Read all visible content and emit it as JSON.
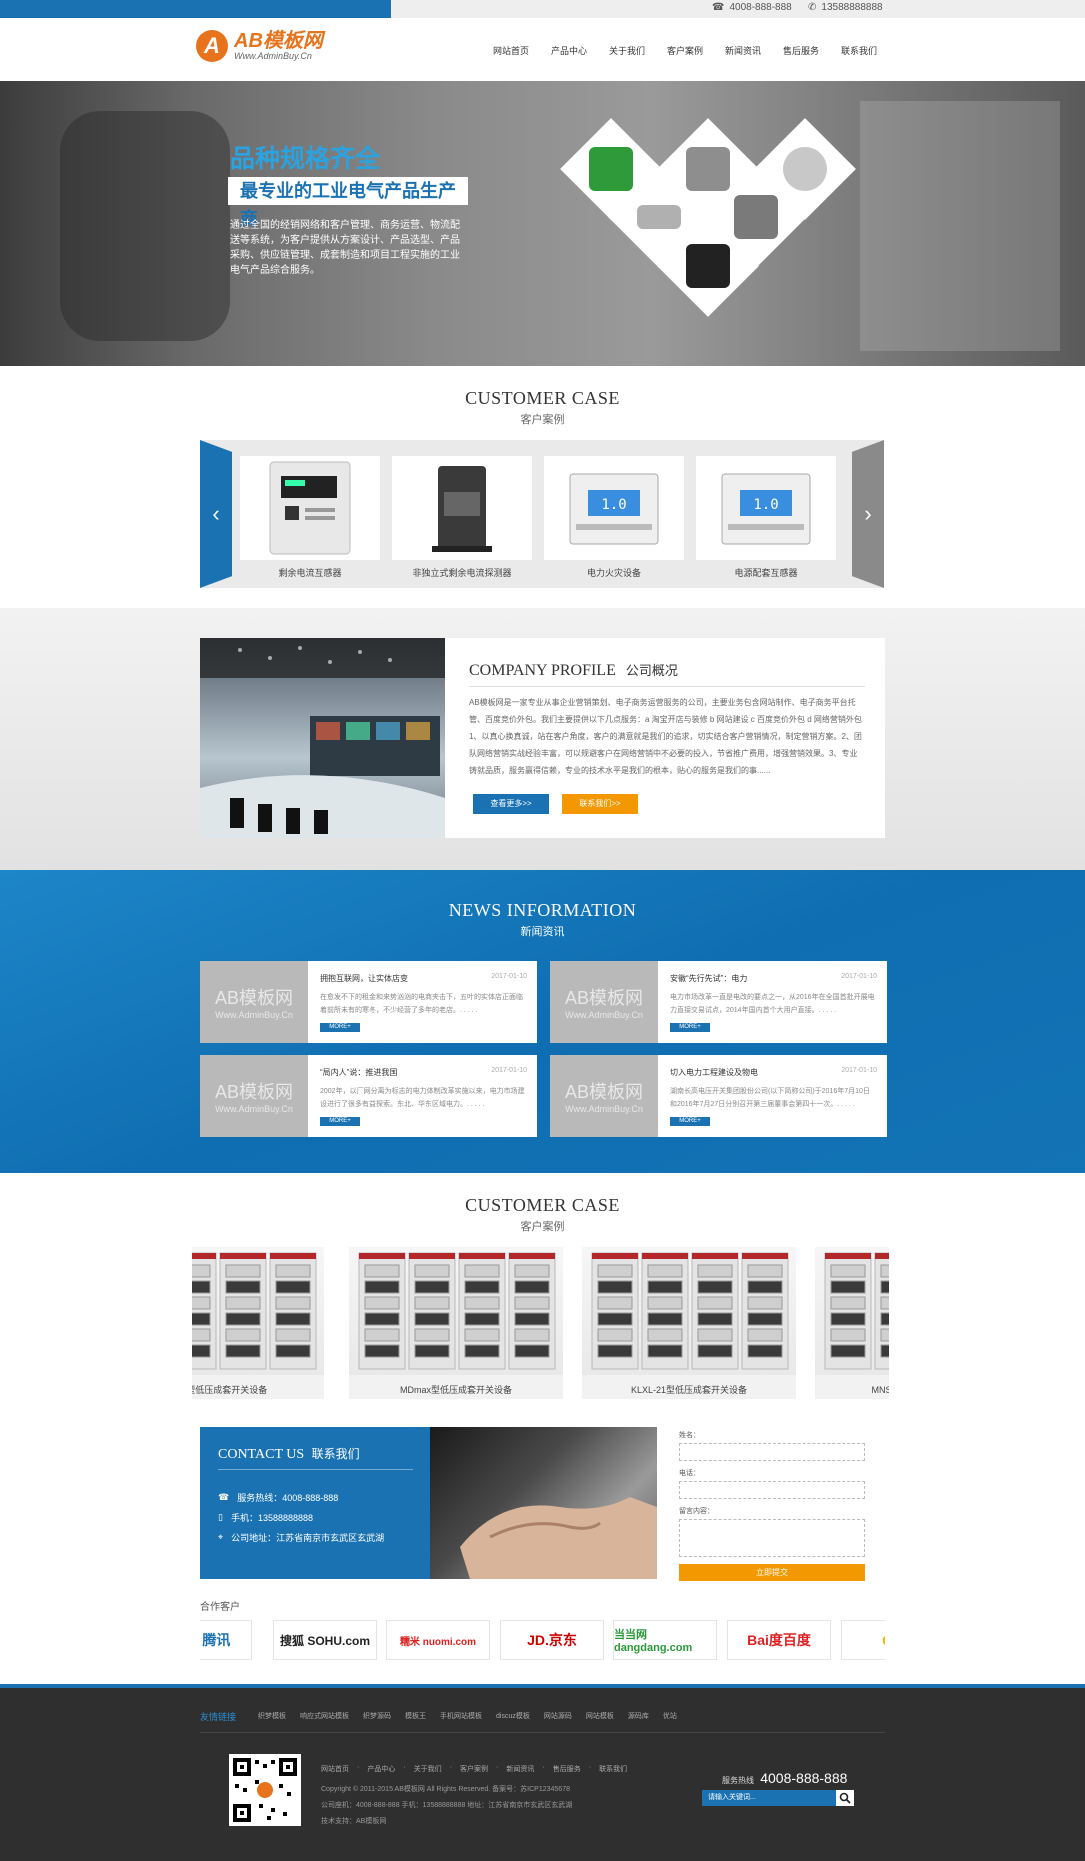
{
  "topbar": {
    "phone1": "4008-888-888",
    "phone2": "13588888888"
  },
  "header": {
    "logo_letter": "A",
    "logo_name": "AB模板网",
    "logo_sub": "Www.AdminBuy.Cn",
    "nav": [
      "网站首页",
      "产品中心",
      "关于我们",
      "客户案例",
      "新闻资讯",
      "售后服务",
      "联系我们"
    ]
  },
  "banner": {
    "headline": "品种规格齐全",
    "subheadline": "最专业的工业电气产品生产商",
    "text": "通过全国的经销网络和客户管理、商务运营、物流配送等系统，为客户提供从方案设计、产品选型、产品采购、供应链管理、成套制造和项目工程实施的工业电气产品综合服务。",
    "dot_colors": [
      "#2a8ed6",
      "#e6a21a",
      "#2a8ed6"
    ]
  },
  "case1": {
    "title_en": "CUSTOMER CASE",
    "title_cn": "客户案例",
    "prev": "‹",
    "next": "›",
    "items": [
      "剩余电流互感器",
      "非独立式剩余电流探测器",
      "电力火灾设备",
      "电源配套互感器"
    ]
  },
  "profile": {
    "title_en": "COMPANY PROFILE",
    "title_cn": "公司概况",
    "text": "AB模板网是一家专业从事企业营销策划、电子商务运营服务的公司，主要业务包含网站制作、电子商务平台托管、百度竞价外包。我们主要提供以下几点服务：a 淘宝开店与装修 b 网站建设 c 百度竞价外包 d 网络营销外包 1、以真心换真诚，站在客户角度，客户的满意就是我们的追求，切实结合客户营销情况，制定营销方案。2、团队网络营销实战经验丰富，可以规避客户在网络营销中不必要的投入，节省推广费用，增强营销效果。3、专业铸就品质，服务赢得信赖，专业的技术水平是我们的根本，贴心的服务是我们的事......",
    "btn_more": "查看更多>>",
    "btn_contact": "联系我们>>"
  },
  "news": {
    "title_en": "NEWS INFORMATION",
    "title_cn": "新闻资讯",
    "thumb_title": "AB模板网",
    "thumb_sub": "Www.AdminBuy.Cn",
    "more": "MORE+",
    "items": [
      {
        "title": "拥抱互联网，让实体店变",
        "date": "2017-01-10",
        "summary": "在愈发不下的租金和来势汹汹的电商夹击下，五叶的实体店正面临着前所未有的寒冬，不少经营了多年的老店。. . . . ."
      },
      {
        "title": "安徽“先行先试”：电力",
        "date": "2017-01-10",
        "summary": "电力市场改革一直是电改的要点之一，从2016年在全国首批开展电力直接交易试点，2014年国内首个大用户直接。. . . . ."
      },
      {
        "title": "“局内人”说：推进我国",
        "date": "2017-01-10",
        "summary": "2002年，以厂网分离为标志的电力体制改革实施以来，电力市场建设进行了很多有益探索。东北、华东区域电力。. . . . ."
      },
      {
        "title": "切入电力工程建设及物电",
        "date": "2017-01-10",
        "summary": "湖南长高电压开关集团股份公司(以下简称公司)于2016年7月10日和2016年7月27日分别召开第三届董事会第四十一次。. . . . ."
      }
    ]
  },
  "case2": {
    "title_en": "CUSTOMER CASE",
    "title_cn": "客户案例",
    "items": [
      "GCS型低压成套开关设备",
      "MDmax型低压成套开关设备",
      "KLXL-21型低压成套开关设备",
      "MNS型低压成套开关设备"
    ]
  },
  "contact": {
    "title_en": "CONTACT US",
    "title_cn": "联系我们",
    "hotline": "服务热线：4008-888-888",
    "mobile": "手机：13588888888",
    "address": "公司地址：江苏省南京市玄武区玄武湖"
  },
  "form": {
    "name_label": "姓名：",
    "phone_label": "电话：",
    "message_label": "留言内容：",
    "submit": "立即提交"
  },
  "partners": {
    "title": "合作客户",
    "items": [
      "cent 腾讯",
      "搜狐 SOHU.com",
      "糯米 nuomi.com",
      "JD.京东",
      "当当网 dangdang.com",
      "Bai度百度",
      "QQ"
    ]
  },
  "footer": {
    "links_label": "友情链接",
    "links": [
      "织梦模板",
      "响应式网站模板",
      "织梦源码",
      "模板王",
      "手机网站模板",
      "discuz模板",
      "网站源码",
      "网站模板",
      "源码库",
      "优站"
    ],
    "nav": [
      "网站首页",
      "·",
      "产品中心",
      "·",
      "关于我们",
      "·",
      "客户案例",
      "·",
      "新闻资讯",
      "·",
      "售后服务",
      "·",
      "联系我们"
    ],
    "copyright": "Copyright © 2011-2015 AB模板网 All Rights Reserved.    备案号：苏ICP12345678",
    "contact_line": "公司座机：4008-888-888    手机：13588888888    地址：江苏省南京市玄武区玄武湖",
    "support": "技术支持：AB模板网",
    "hotline_label": "服务热线",
    "hotline": "4008-888-888",
    "search_placeholder": "请输入关键词..."
  }
}
